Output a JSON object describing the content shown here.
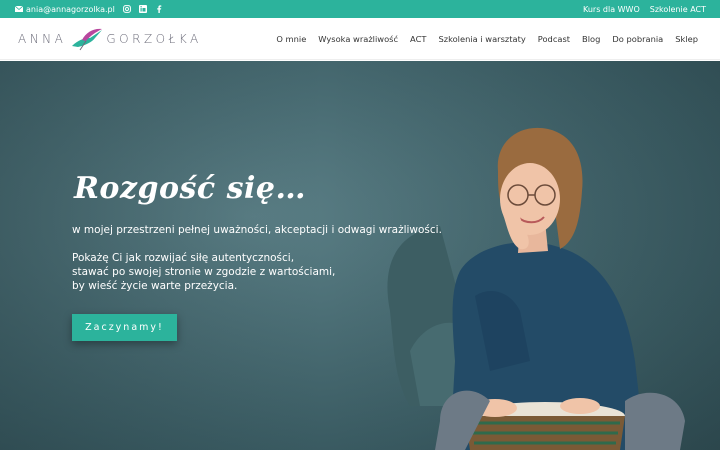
{
  "topbar": {
    "email": "ania@annagorzolka.pl",
    "icons": [
      "mail-icon",
      "instagram-icon",
      "linkedin-icon",
      "facebook-icon"
    ],
    "links": [
      "Kurs dla WWO",
      "Szkolenie ACT"
    ]
  },
  "header": {
    "logo_left": "ANNA",
    "logo_right": "GORZOŁKA",
    "nav": [
      "O mnie",
      "Wysoka wrażliwość",
      "ACT",
      "Szkolenia i warsztaty",
      "Podcast",
      "Blog",
      "Do pobrania",
      "Sklep"
    ]
  },
  "hero": {
    "title": "Rozgość się…",
    "subtitle": "w mojej przestrzeni pełnej uważności, akceptacji i odwagi wrażliwości.",
    "lines": [
      "Pokażę Ci jak rozwijać siłę autentyczności,",
      "stawać po swojej stronie w zgodzie z wartościami,",
      "by wieść życie warte przeżycia."
    ],
    "cta": "Zaczynamy!"
  },
  "colors": {
    "accent": "#2cb39c",
    "hero_bg": "#4a6d74"
  }
}
